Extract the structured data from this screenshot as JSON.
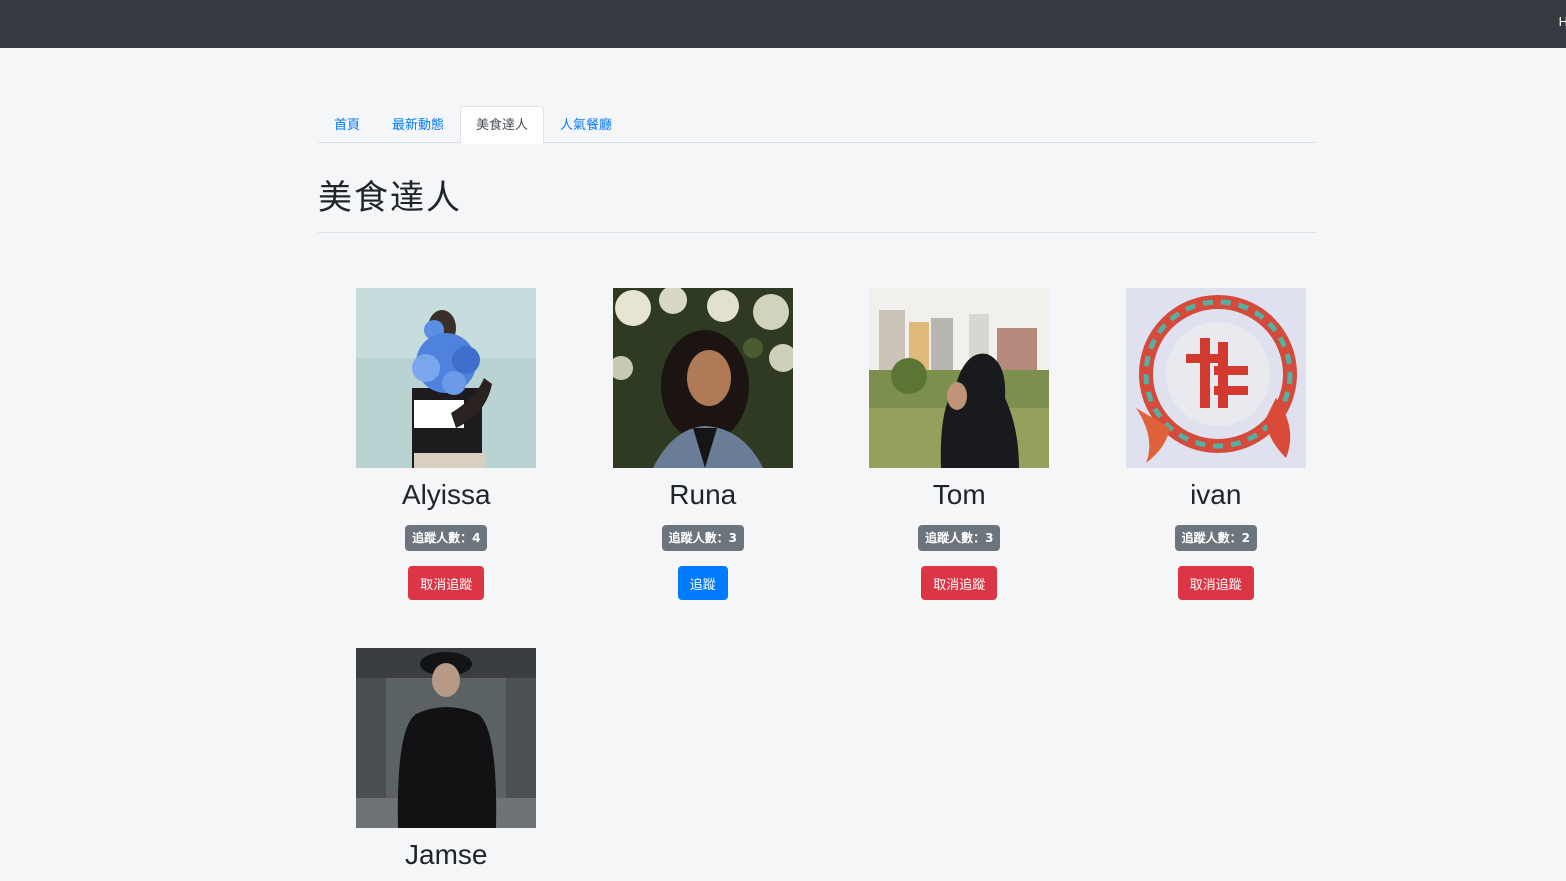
{
  "navbar": {
    "edge_text": "H"
  },
  "tabs": [
    {
      "label": "首頁",
      "active": false
    },
    {
      "label": "最新動態",
      "active": false
    },
    {
      "label": "美食達人",
      "active": true
    },
    {
      "label": "人氣餐廳",
      "active": false
    }
  ],
  "page_title": "美食達人",
  "experts": [
    {
      "name": "Alyissa",
      "followers": "追蹤人數：4",
      "button": "取消追蹤",
      "button_style": "danger",
      "photo": "woman-with-blue-flowers-photo"
    },
    {
      "name": "Runa",
      "followers": "追蹤人數：3",
      "button": "追蹤",
      "button_style": "primary",
      "photo": "woman-among-flowering-tree-photo"
    },
    {
      "name": "Tom",
      "followers": "追蹤人數：3",
      "button": "取消追蹤",
      "button_style": "danger",
      "photo": "man-in-hood-field-photo"
    },
    {
      "name": "ivan",
      "followers": "追蹤人數：2",
      "button": "取消追蹤",
      "button_style": "danger",
      "photo": "red-dragon-sign-photo"
    },
    {
      "name": "Jamse",
      "followers": "",
      "button": "",
      "button_style": "",
      "photo": "man-in-black-street-photo"
    }
  ],
  "colors": {
    "navbar": "#343a40",
    "primary": "#007bff",
    "danger": "#dc3545",
    "badge": "#6c757d",
    "background": "#f5f6f8"
  }
}
